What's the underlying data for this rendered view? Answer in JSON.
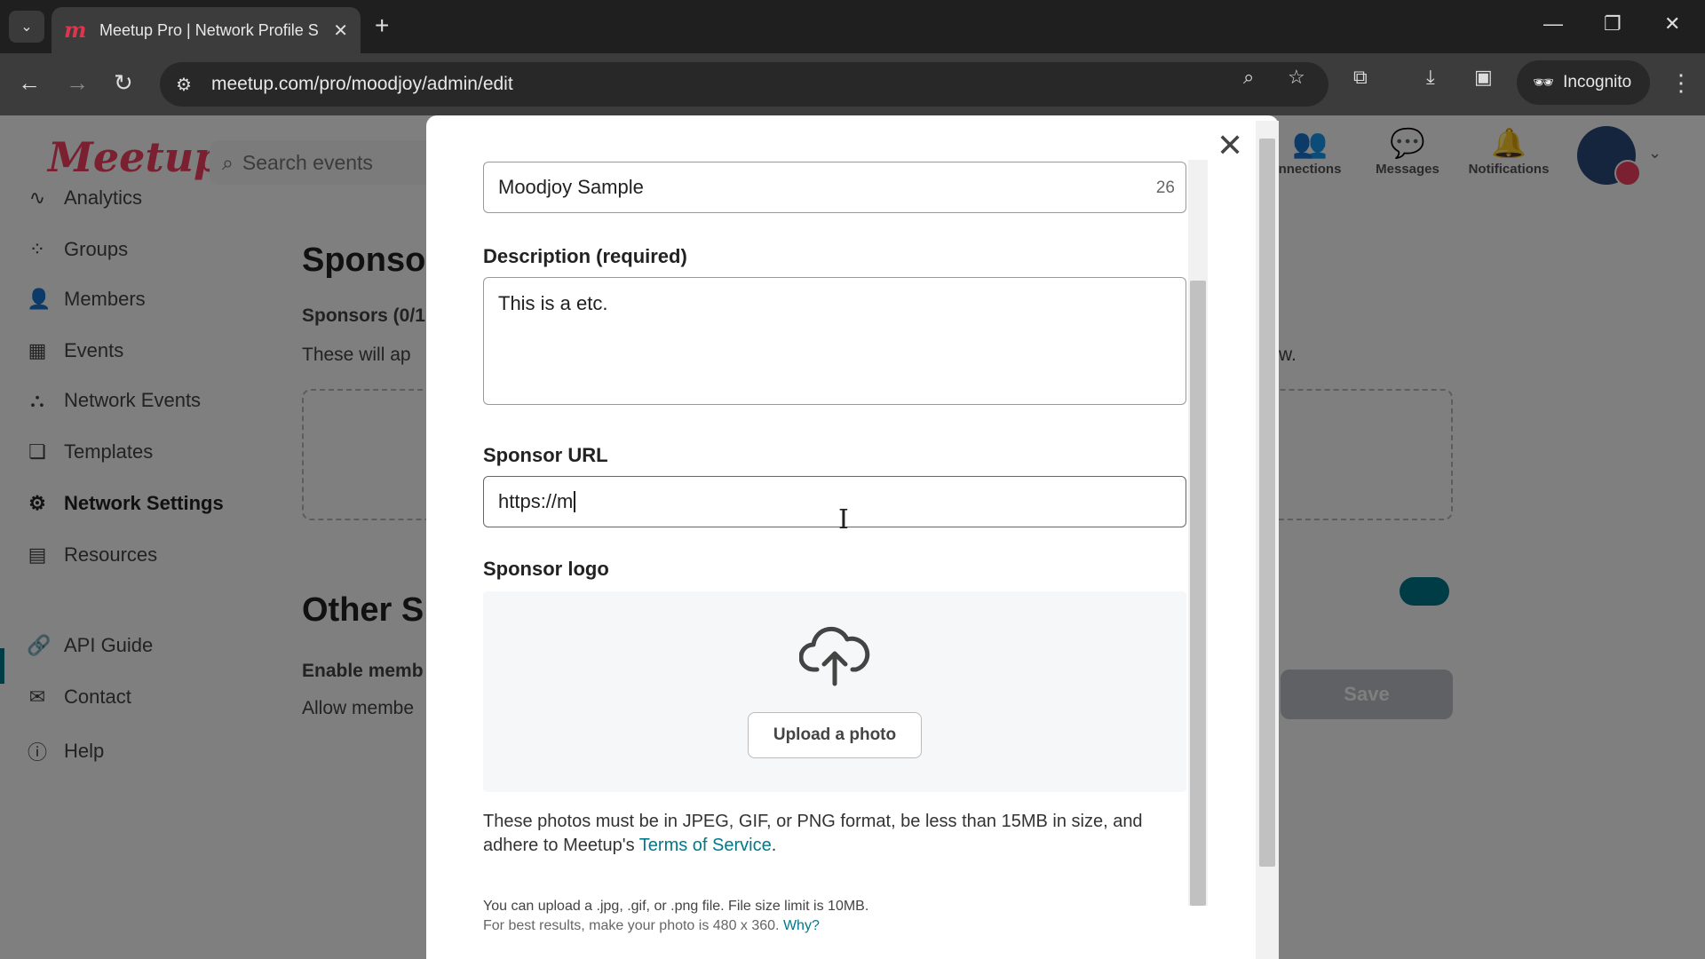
{
  "browser": {
    "tab_title": "Meetup Pro | Network Profile S",
    "url": "meetup.com/pro/moodjoy/admin/edit",
    "incognito_label": "Incognito"
  },
  "header": {
    "logo": "Meetup",
    "search_placeholder": "Search events",
    "icons": [
      {
        "label": "nnections"
      },
      {
        "label": "Messages"
      },
      {
        "label": "Notifications"
      }
    ]
  },
  "sidebar": {
    "items": [
      {
        "label": "Analytics",
        "icon": "analytics-icon"
      },
      {
        "label": "Groups",
        "icon": "groups-icon"
      },
      {
        "label": "Members",
        "icon": "members-icon"
      },
      {
        "label": "Events",
        "icon": "calendar-icon"
      },
      {
        "label": "Network Events",
        "icon": "network-events-icon"
      },
      {
        "label": "Templates",
        "icon": "templates-icon"
      },
      {
        "label": "Network Settings",
        "icon": "gear-icon",
        "active": true
      },
      {
        "label": "Resources",
        "icon": "resources-icon"
      },
      {
        "label": "API Guide",
        "icon": "link-icon"
      },
      {
        "label": "Contact",
        "icon": "mail-icon"
      },
      {
        "label": "Help",
        "icon": "help-icon"
      }
    ]
  },
  "main": {
    "sponsors_heading": "Sponso",
    "sponsors_count": "Sponsors (0/1",
    "sponsors_desc_left": "These will ap",
    "sponsors_desc_right": "w.",
    "other_heading": "Other S",
    "enable_label": "Enable memb",
    "allow_label": "Allow membe",
    "save_label": "Save"
  },
  "modal": {
    "name_value": "Moodjoy Sample",
    "name_counter": "26",
    "description_label": "Description (required)",
    "description_value": "This is a etc.",
    "url_label": "Sponsor URL",
    "url_value": "https://m",
    "logo_label": "Sponsor logo",
    "upload_button": "Upload a photo",
    "info_text_1": "These photos must be in JPEG, GIF, or PNG format, be less than 15MB in size, and adhere to Meetup's ",
    "tos_link": "Terms of Service",
    "info_text_end": ".",
    "small_text_1": "You can upload a .jpg, .gif, or .png file. File size limit is 10MB.",
    "small_text_2": "For best results, make your photo is 480 x 360. ",
    "why_link": "Why?"
  },
  "colors": {
    "brand": "#f64060",
    "accent": "#00798a"
  }
}
